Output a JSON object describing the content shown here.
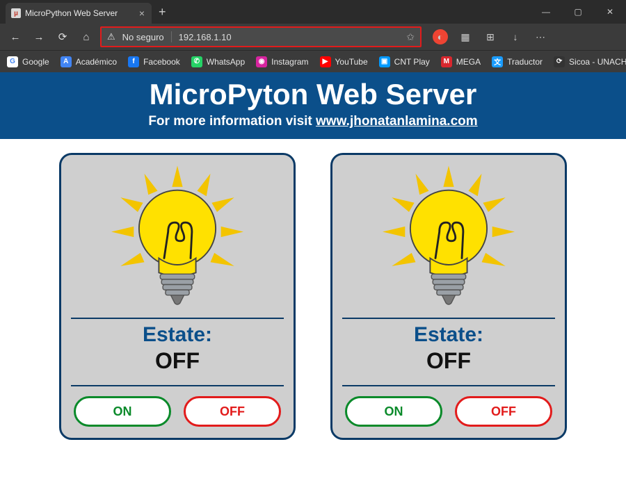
{
  "window": {
    "tab_title": "MicroPython Web Server"
  },
  "address_bar": {
    "security_text": "No seguro",
    "url": "192.168.1.10"
  },
  "bookmarks": [
    {
      "label": "Google",
      "bg": "#ffffff",
      "fg": "#4285f4",
      "glyph": "G"
    },
    {
      "label": "Académico",
      "bg": "#4285f4",
      "fg": "#ffffff",
      "glyph": "A"
    },
    {
      "label": "Facebook",
      "bg": "#1877f2",
      "fg": "#ffffff",
      "glyph": "f"
    },
    {
      "label": "WhatsApp",
      "bg": "#25d366",
      "fg": "#ffffff",
      "glyph": "✆"
    },
    {
      "label": "Instagram",
      "bg": "#d6249f",
      "fg": "#ffffff",
      "glyph": "◉"
    },
    {
      "label": "YouTube",
      "bg": "#ff0000",
      "fg": "#ffffff",
      "glyph": "▶"
    },
    {
      "label": "CNT Play",
      "bg": "#0099ff",
      "fg": "#ffffff",
      "glyph": "▣"
    },
    {
      "label": "MEGA",
      "bg": "#d9272e",
      "fg": "#ffffff",
      "glyph": "M"
    },
    {
      "label": "Traductor",
      "bg": "#1a9cff",
      "fg": "#ffffff",
      "glyph": "文"
    },
    {
      "label": "Sicoa - UNACH",
      "bg": "#333333",
      "fg": "#ffffff",
      "glyph": "⟳"
    }
  ],
  "hero": {
    "title": "MicroPyton Web Server",
    "subtitle_prefix": "For more information visit ",
    "subtitle_link_text": "www.jhonatanlamina.com"
  },
  "cards": [
    {
      "status_label": "Estate:",
      "status_value": "OFF",
      "on_label": "ON",
      "off_label": "OFF"
    },
    {
      "status_label": "Estate:",
      "status_value": "OFF",
      "on_label": "ON",
      "off_label": "OFF"
    }
  ]
}
